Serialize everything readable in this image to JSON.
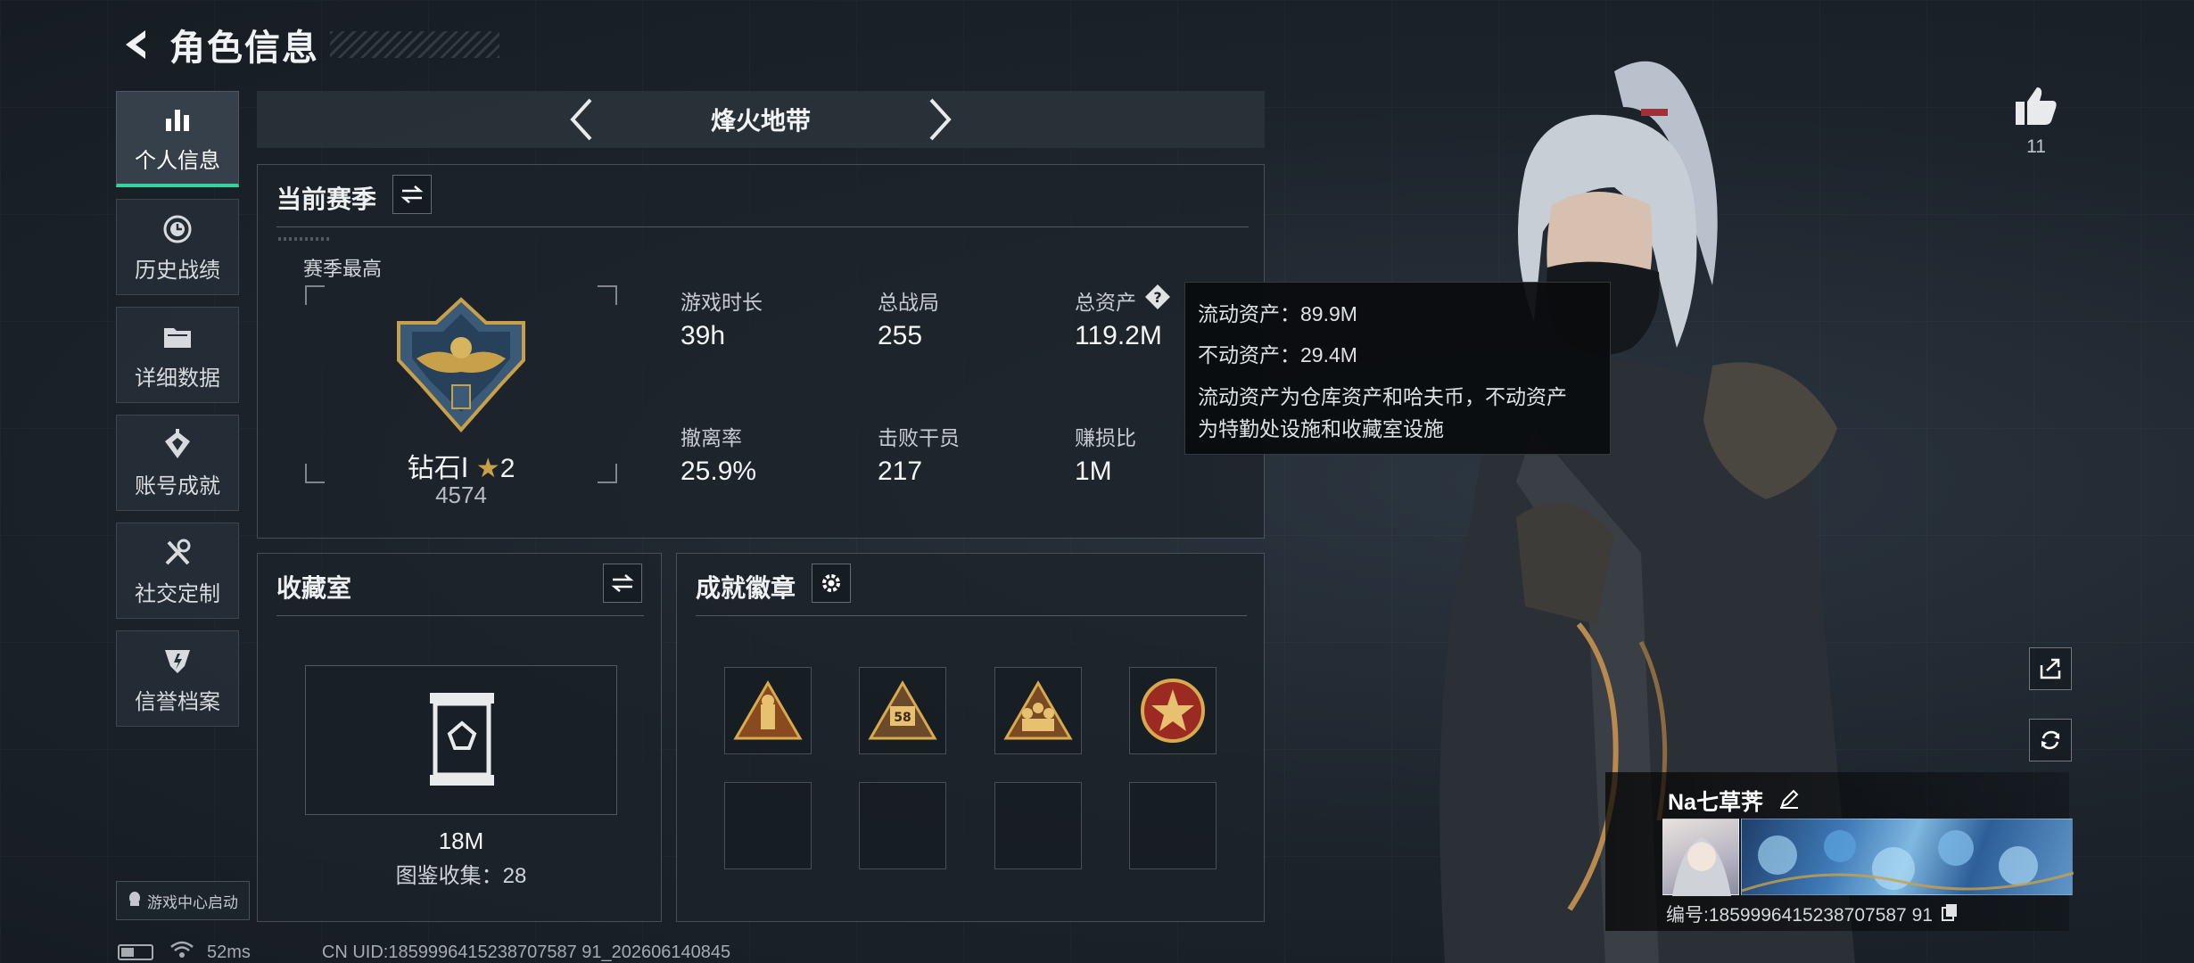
{
  "header": {
    "title": "角色信息"
  },
  "sidebar": {
    "items": [
      {
        "label": "个人信息",
        "icon": "bar-chart-icon",
        "active": true
      },
      {
        "label": "历史战绩",
        "icon": "history-icon"
      },
      {
        "label": "详细数据",
        "icon": "folder-icon"
      },
      {
        "label": "账号成就",
        "icon": "achievement-icon"
      },
      {
        "label": "社交定制",
        "icon": "tools-icon"
      },
      {
        "label": "信誉档案",
        "icon": "credit-icon"
      }
    ],
    "launch_label": "游戏中心启动"
  },
  "status": {
    "ping": "52ms",
    "uid": "CN UID:1859996415238707587 91_202606140845"
  },
  "mode": {
    "name": "烽火地带"
  },
  "season": {
    "title": "当前赛季",
    "best_label": "赛季最高",
    "rank_name": "钻石Ⅰ",
    "rank_stars": "2",
    "rank_score": "4574",
    "stats": [
      {
        "label": "游戏时长",
        "value": "39h"
      },
      {
        "label": "总战局",
        "value": "255"
      },
      {
        "label": "总资产",
        "value": "119.2M"
      },
      {
        "label": "撤离率",
        "value": "25.9%"
      },
      {
        "label": "击败干员",
        "value": "217"
      },
      {
        "label": "赚损比",
        "value": "1M"
      }
    ]
  },
  "tooltip": {
    "liquid": "流动资产：89.9M",
    "fixed": "不动资产：29.4M",
    "desc_line1": "流动资产为仓库资产和哈夫币，不动资产",
    "desc_line2": "为特勤处设施和收藏室设施"
  },
  "collection": {
    "title": "收藏室",
    "value": "18M",
    "atlas_label": "图鉴收集：28"
  },
  "badges": {
    "title": "成就徽章",
    "slots": [
      "badge-triangle-soldier",
      "badge-58",
      "badge-triangle-squad",
      "badge-star-emblem",
      "empty",
      "empty",
      "empty",
      "empty"
    ]
  },
  "profile": {
    "like_count": "11",
    "player_name": "Na七草荠",
    "player_id": "编号:1859996415238707587 91"
  },
  "colors": {
    "accent": "#35d3a0",
    "gold": "#c9a04a"
  }
}
